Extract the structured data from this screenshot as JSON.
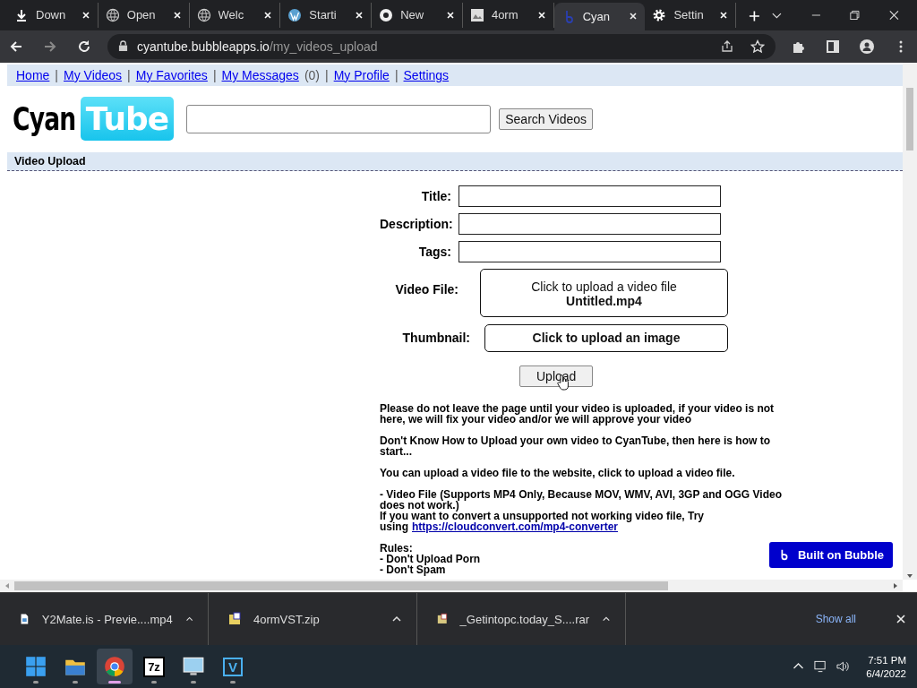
{
  "tabs": [
    {
      "label": "Down",
      "selected": false
    },
    {
      "label": "Open",
      "selected": false
    },
    {
      "label": "Welc",
      "selected": false
    },
    {
      "label": "Starti",
      "selected": false
    },
    {
      "label": "New",
      "selected": false
    },
    {
      "label": "4orm",
      "selected": false
    },
    {
      "label": "Cyan",
      "selected": true
    },
    {
      "label": "Settin",
      "selected": false
    }
  ],
  "address": {
    "host": "cyantube.bubbleapps.io",
    "path": "/my_videos_upload"
  },
  "nav": [
    {
      "label": "Home"
    },
    {
      "separator": "|",
      "label": "My Videos"
    },
    {
      "separator": "|",
      "label": "My Favorites"
    },
    {
      "separator": "|",
      "label": "My Messages",
      "count": "(0)"
    },
    {
      "separator": "|",
      "label": "My Profile"
    },
    {
      "separator": "|",
      "label": "Settings"
    }
  ],
  "logo": {
    "left": "Cyan",
    "right": "Tube"
  },
  "search": {
    "button": "Search Videos"
  },
  "section_title": "Video Upload",
  "form": [
    {
      "kind": "input",
      "label": "Title:"
    },
    {
      "kind": "input",
      "label": "Description:"
    },
    {
      "kind": "input",
      "label": "Tags:"
    },
    {
      "kind": "file",
      "label": "Video File:",
      "text": "Click to upload a video file",
      "file": "Untitled.mp4"
    },
    {
      "kind": "image",
      "label": "Thumbnail:",
      "text": "Click to upload an image"
    }
  ],
  "upload_button": "Upload",
  "notes": [
    [
      {
        "text": "Please do not leave the page until your video is uploaded, if your video is not here, we will fix your video and/or we will approve your video"
      }
    ],
    [
      {
        "text": "Don't Know How to Upload your own video to CyanTube, then here is how to start..."
      }
    ],
    [
      {
        "text": "You can upload a video file to the website, click to upload a video file."
      }
    ],
    [
      {
        "text": "- Video File (Supports MP4 Only, Because MOV, WMV, AVI, 3GP and OGG Video does not work.)"
      },
      {
        "text": "If you want to convert a unsupported not working video file, Try"
      },
      {
        "text": "using",
        "link": "https://cloudconvert.com/mp4-converter"
      }
    ],
    [
      {
        "text": "Rules:"
      },
      {
        "text": "- Don't Upload Porn"
      },
      {
        "text": "- Don't Spam"
      }
    ]
  ],
  "bubble_badge": "Built on Bubble",
  "downloads": [
    {
      "name": "Y2Mate.is - Previe....mp4"
    },
    {
      "name": "4ormVST.zip"
    },
    {
      "name": "_Getintopc.today_S....rar"
    }
  ],
  "show_all": "Show all",
  "taskbar": {
    "apps": [
      {
        "selected": false
      },
      {
        "selected": false
      },
      {
        "selected": true
      },
      {
        "label": "7z",
        "selected": false
      },
      {
        "selected": false
      },
      {
        "label": "V",
        "selected": false
      }
    ],
    "time": "7:51 PM",
    "date": "6/4/2022"
  }
}
